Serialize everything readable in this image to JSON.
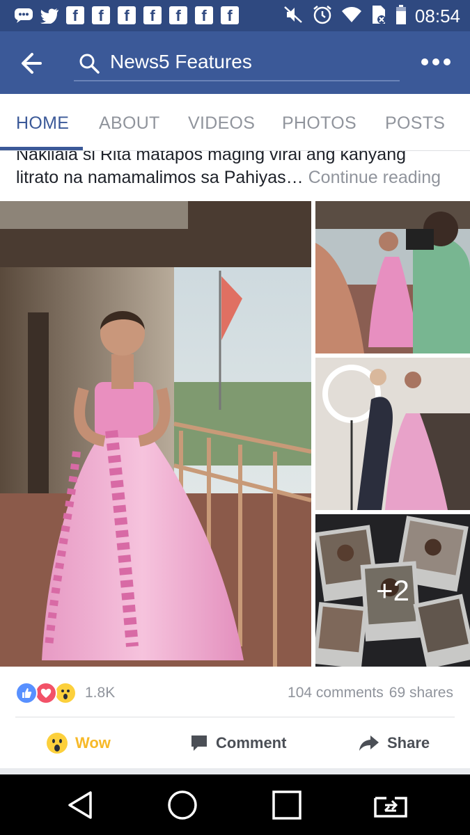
{
  "status_bar": {
    "time": "08:54",
    "left_icons": [
      "messenger-icon",
      "twitter-icon",
      "facebook-icon",
      "facebook-icon",
      "facebook-icon",
      "facebook-icon",
      "facebook-icon",
      "facebook-icon",
      "facebook-icon"
    ],
    "fb_letter": "f",
    "right_icons": [
      "mute-icon",
      "alarm-icon",
      "wifi-icon",
      "sim-icon",
      "battery-icon"
    ]
  },
  "app_bar": {
    "search_text": "News5 Features"
  },
  "tabs": [
    {
      "label": "HOME",
      "active": true
    },
    {
      "label": "ABOUT",
      "active": false
    },
    {
      "label": "VIDEOS",
      "active": false
    },
    {
      "label": "PHOTOS",
      "active": false
    },
    {
      "label": "POSTS",
      "active": false
    }
  ],
  "post": {
    "text_line1": "Nakilala si Rita matapos maging viral ang kanyang",
    "text_line2": "litrato na namamalimos sa Pahiyas…",
    "continue_label": "Continue reading",
    "more_photos": "+2",
    "reaction_count": "1.8K",
    "comments": "104 comments",
    "shares": "69 shares"
  },
  "actions": {
    "wow": "Wow",
    "comment": "Comment",
    "share": "Share"
  },
  "colors": {
    "brand": "#3b5998",
    "status_bar": "#2f4980",
    "wow_yellow": "#f7b928",
    "muted_text": "#90949c"
  }
}
